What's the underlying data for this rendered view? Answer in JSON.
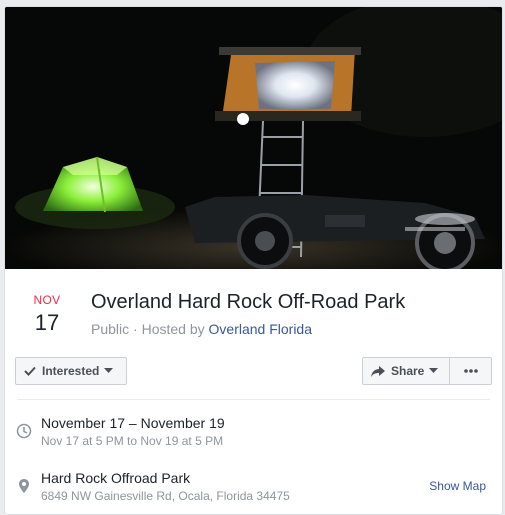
{
  "event": {
    "date": {
      "month": "NOV",
      "day": "17"
    },
    "title": "Overland Hard Rock Off-Road Park",
    "privacy": "Public",
    "hosted_by_prefix": "· Hosted by",
    "host": "Overland Florida"
  },
  "actions": {
    "interested_label": "Interested",
    "share_label": "Share"
  },
  "when": {
    "range": "November 17 – November 19",
    "detail": "Nov 17 at 5 PM to Nov 19 at 5 PM"
  },
  "where": {
    "name": "Hard Rock Offroad Park",
    "address": "6849 NW Gainesville Rd, Ocala, Florida 34475",
    "show_map_label": "Show Map"
  },
  "icons": {
    "check": "check-icon",
    "caret": "caret-down-icon",
    "share": "share-arrow-icon",
    "more": "more-dots-icon",
    "clock": "clock-icon",
    "pin": "location-pin-icon"
  },
  "colors": {
    "month": "#f02849",
    "link": "#385898",
    "muted": "#90949c"
  }
}
